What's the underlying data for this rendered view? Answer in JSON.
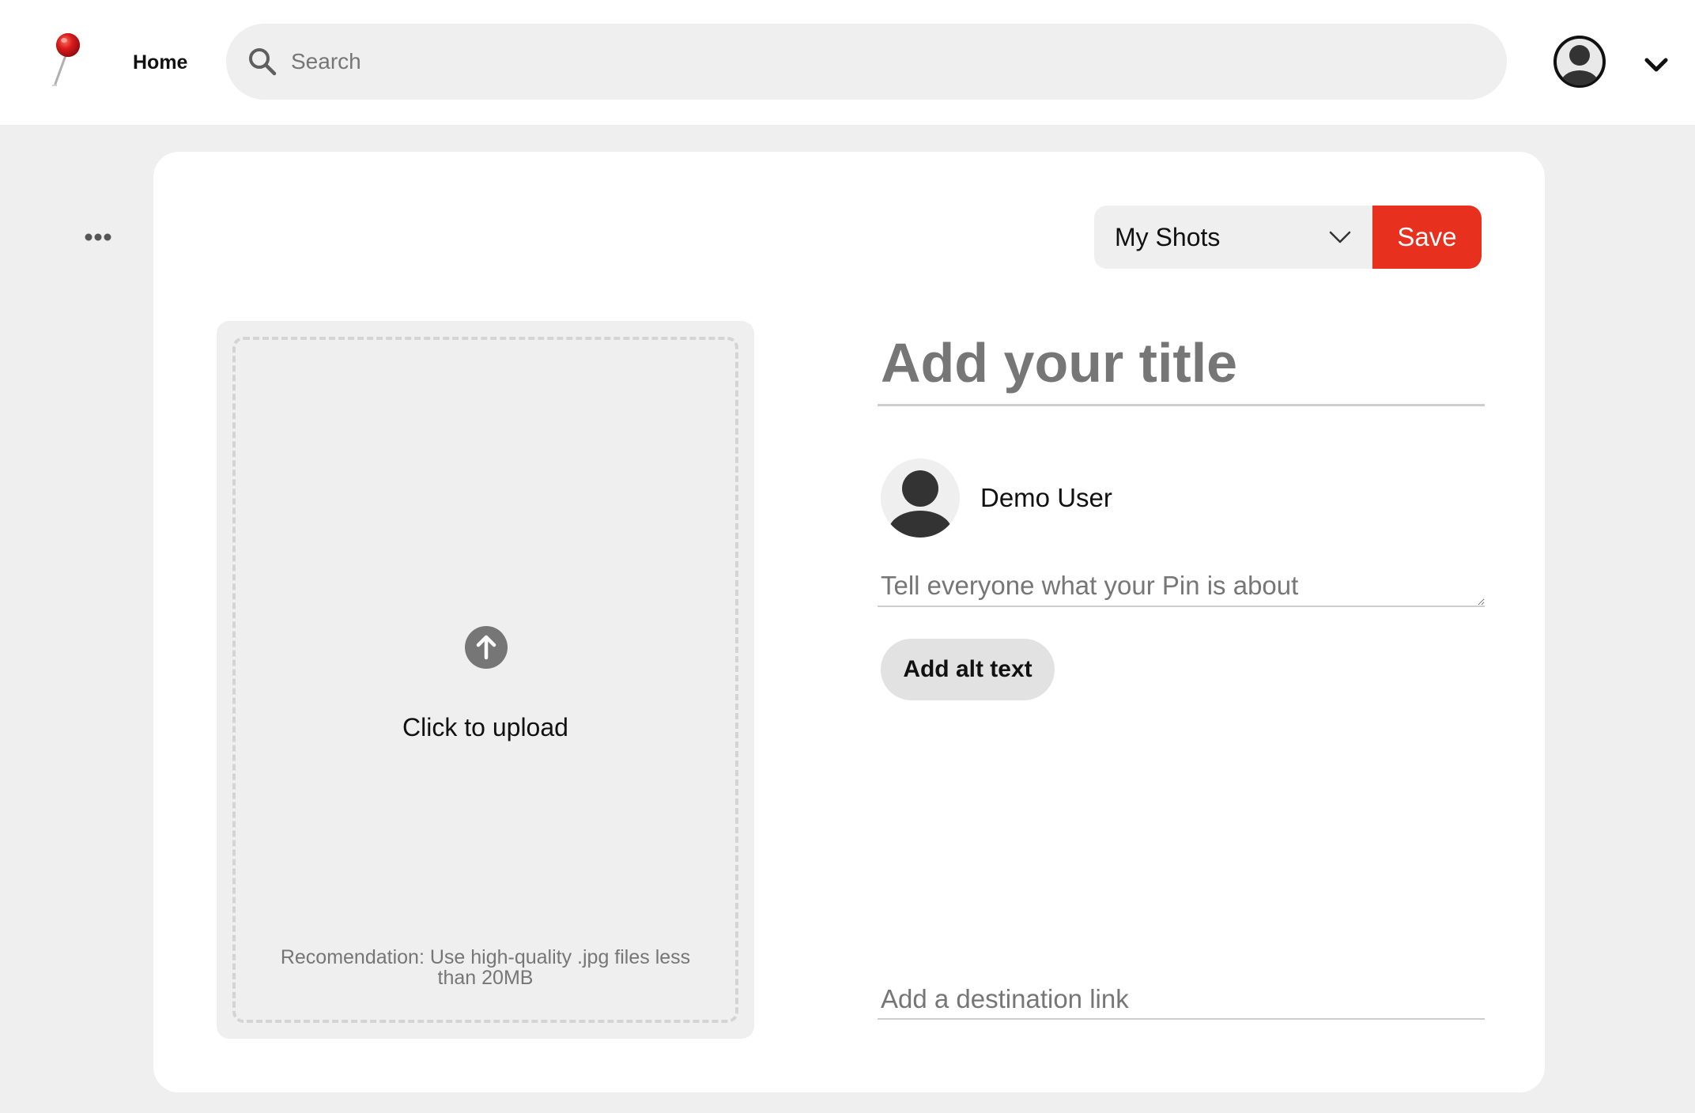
{
  "header": {
    "logo": "red-pushpin-icon",
    "nav": {
      "home_label": "Home"
    },
    "search": {
      "placeholder": "Search",
      "icon": "search-icon"
    },
    "account": {
      "avatar_icon": "user-avatar-icon",
      "menu_icon": "chevron-down-icon"
    }
  },
  "toolbar": {
    "more_icon": "ellipsis-icon",
    "board_select": {
      "selected": "My Shots",
      "icon": "chevron-down-icon"
    },
    "save_label": "Save"
  },
  "upload": {
    "icon": "arrow-up-circle-icon",
    "label": "Click to upload",
    "hint": "Recomendation: Use high-quality .jpg files less than 20MB"
  },
  "form": {
    "title_placeholder": "Add your title",
    "user": {
      "name": "Demo User",
      "avatar_icon": "user-avatar-icon"
    },
    "description_placeholder": "Tell everyone what your Pin is about",
    "alt_text_label": "Add alt text",
    "link_placeholder": "Add a destination link"
  },
  "colors": {
    "accent": "#e8301f",
    "page_background": "#efefef",
    "surface": "#ffffff",
    "placeholder_text": "#767676"
  }
}
